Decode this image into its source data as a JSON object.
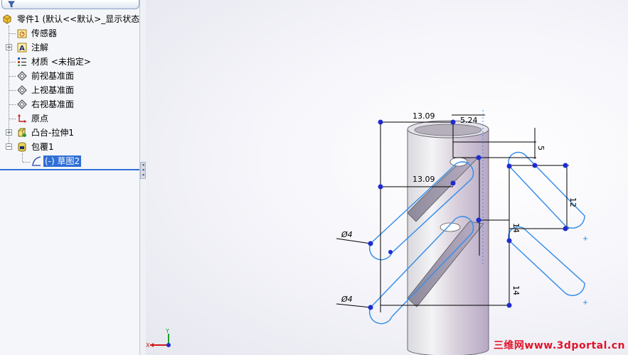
{
  "feature_tree": {
    "root": {
      "label": "零件1 (默认<<默认>_显示状态",
      "icon": "part-icon"
    },
    "items": [
      {
        "label": "传感器",
        "icon": "sensor-icon",
        "expandable": false
      },
      {
        "label": "注解",
        "icon": "annotation-icon",
        "expandable": true
      },
      {
        "label": "材质 <未指定>",
        "icon": "material-icon",
        "expandable": false
      },
      {
        "label": "前视基准面",
        "icon": "plane-icon",
        "expandable": false
      },
      {
        "label": "上视基准面",
        "icon": "plane-icon",
        "expandable": false
      },
      {
        "label": "右视基准面",
        "icon": "plane-icon",
        "expandable": false
      },
      {
        "label": "原点",
        "icon": "origin-icon",
        "expandable": false
      },
      {
        "label": "凸台-拉伸1",
        "icon": "extrude-icon",
        "expandable": true
      },
      {
        "label": "包覆1",
        "icon": "wrap-icon",
        "expandable": true
      }
    ],
    "selected_child": {
      "label": "(-) 草图2",
      "icon": "sketch-icon"
    }
  },
  "dimensions": {
    "top_width": "13.09",
    "offset": "5.24",
    "mid_width": "13.09",
    "top_vertical": "5",
    "right_vertical": "12",
    "lower_vertical": "14",
    "upper_vertical": "14",
    "diameter_upper": "Ø4",
    "diameter_lower": "Ø4"
  },
  "triad": {
    "x_label": "X",
    "y_label": "Y"
  },
  "watermark": "三维网www.3dportal.cn",
  "colors": {
    "sketch": "#3a8fe8",
    "dimension": "#000000",
    "point": "#1f2ad0",
    "tree_bg": "#f4f6f9",
    "selection": "#2f6fd6"
  }
}
